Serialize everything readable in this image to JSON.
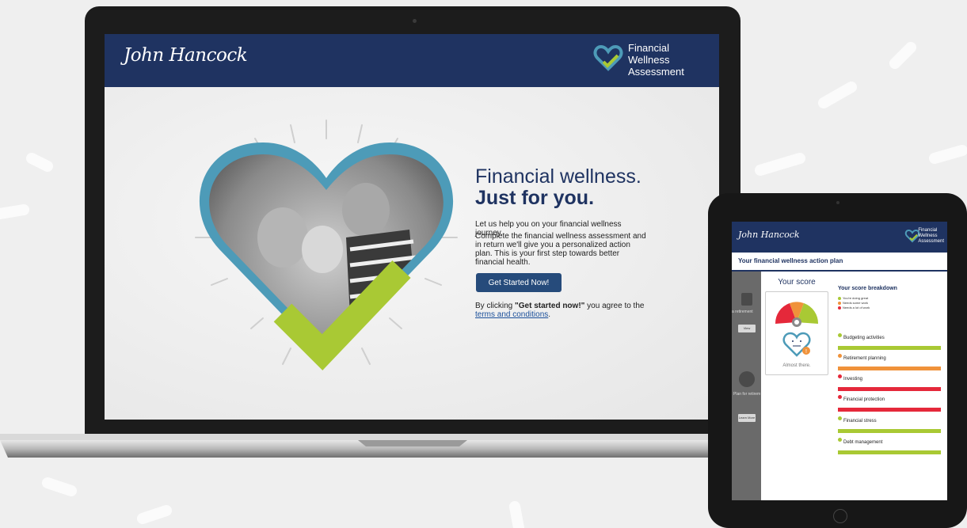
{
  "laptop": {
    "brand": "John Hancock",
    "fwa_lines": [
      "Financial",
      "Wellness",
      "Assessment"
    ],
    "hero_title_line1": "Financial wellness.",
    "hero_title_line2": "Just for you.",
    "intro": "Let us help you on your financial wellness journey.",
    "description": "Complete the financial wellness assessment and in return we'll give you a personalized action plan. This is your first step towards better financial health.",
    "cta_label": "Get Started Now!",
    "agree_prefix": "By clicking ",
    "agree_bold": "\"Get started now!\"",
    "agree_middle": " you agree to the",
    "terms_link": "terms and conditions",
    "agree_suffix": ".",
    "colors": {
      "navy": "#1f3361",
      "teal": "#4d9bb8",
      "lime": "#a9c934",
      "button": "#264b7b"
    }
  },
  "tablet": {
    "brand": "John Hancock",
    "fwa_lines": [
      "Financial",
      "Wellness",
      "Assessment"
    ],
    "plan_title": "Your financial wellness action plan",
    "score_label": "Your score",
    "score_status": "Almost there.",
    "breakdown_title": "Your score breakdown",
    "legend": [
      {
        "label": "You're doing great",
        "color": "#a9c934"
      },
      {
        "label": "Needs some work",
        "color": "#f0923a"
      },
      {
        "label": "Needs a lot of work",
        "color": "#e5283a"
      }
    ],
    "categories": [
      {
        "label": "Budgeting activities",
        "color": "#a9c934"
      },
      {
        "label": "Retirement planning",
        "color": "#f0923a"
      },
      {
        "label": "Investing",
        "color": "#e5283a"
      },
      {
        "label": "Financial protection",
        "color": "#e5283a"
      },
      {
        "label": "Financial stress",
        "color": "#a9c934"
      },
      {
        "label": "Debt management",
        "color": "#a9c934"
      }
    ],
    "ghost": {
      "item1": "a retirement",
      "button1": "View",
      "item2": "Plan for retirem",
      "button2": "Learn More"
    }
  }
}
